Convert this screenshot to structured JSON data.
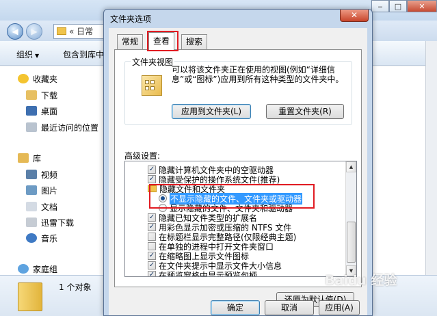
{
  "explorer": {
    "address_text": "« 日常",
    "toolbar": {
      "organize_label": "组织",
      "include_label": "包含到库中"
    },
    "nav": [
      {
        "label": "收藏夹",
        "icon": "star-icon",
        "kind": "header"
      },
      {
        "label": "下载",
        "icon": "download-folder-icon",
        "kind": "item"
      },
      {
        "label": "桌面",
        "icon": "desktop-icon",
        "kind": "item"
      },
      {
        "label": "最近访问的位置",
        "icon": "recent-places-icon",
        "kind": "item"
      },
      {
        "label": "库",
        "icon": "library-icon",
        "kind": "header"
      },
      {
        "label": "视频",
        "icon": "video-icon",
        "kind": "item"
      },
      {
        "label": "图片",
        "icon": "picture-icon",
        "kind": "item"
      },
      {
        "label": "文档",
        "icon": "document-icon",
        "kind": "item"
      },
      {
        "label": "迅雷下载",
        "icon": "thunder-download-icon",
        "kind": "item"
      },
      {
        "label": "音乐",
        "icon": "music-icon",
        "kind": "item"
      },
      {
        "label": "家庭组",
        "icon": "homegroup-icon",
        "kind": "header"
      }
    ],
    "status_text": "1 个对象"
  },
  "dialog": {
    "title": "文件夹选项",
    "close_glyph": "✕",
    "tabs": [
      {
        "label": "常规",
        "active": false
      },
      {
        "label": "查看",
        "active": true
      },
      {
        "label": "搜索",
        "active": false
      }
    ],
    "folder_views": {
      "legend": "文件夹视图",
      "description": "可以将该文件夹正在使用的视图(例如“详细信息”或“图标”)应用到所有这种类型的文件夹中。",
      "apply_button": "应用到文件夹(L)",
      "reset_button": "重置文件夹(R)"
    },
    "advanced_label": "高级设置:",
    "settings": [
      {
        "type": "checkbox",
        "checked": true,
        "label": "隐藏计算机文件夹中的空驱动器"
      },
      {
        "type": "checkbox",
        "checked": true,
        "label": "隐藏受保护的操作系统文件(推荐)"
      },
      {
        "type": "folder",
        "label": "隐藏文件和文件夹"
      },
      {
        "type": "radio",
        "checked": true,
        "selected": true,
        "label": "不显示隐藏的文件、文件夹或驱动器"
      },
      {
        "type": "radio",
        "checked": false,
        "label": "显示隐藏的文件、文件夹和驱动器"
      },
      {
        "type": "checkbox",
        "checked": true,
        "label": "隐藏已知文件类型的扩展名"
      },
      {
        "type": "checkbox",
        "checked": true,
        "label": "用彩色显示加密或压缩的 NTFS 文件"
      },
      {
        "type": "checkbox",
        "checked": false,
        "label": "在标题栏显示完整路径(仅限经典主题)"
      },
      {
        "type": "checkbox",
        "checked": false,
        "label": "在单独的进程中打开文件夹窗口"
      },
      {
        "type": "checkbox",
        "checked": true,
        "label": "在缩略图上显示文件图标"
      },
      {
        "type": "checkbox",
        "checked": true,
        "label": "在文件夹提示中显示文件大小信息"
      },
      {
        "type": "checkbox",
        "checked": true,
        "label": "在预览窗格中显示预览句柄"
      }
    ],
    "restore_button": "还原为默认值(D)",
    "ok_button": "确定",
    "cancel_button": "取消",
    "apply_button": "应用(A)"
  },
  "watermark": "Baidu 经验"
}
